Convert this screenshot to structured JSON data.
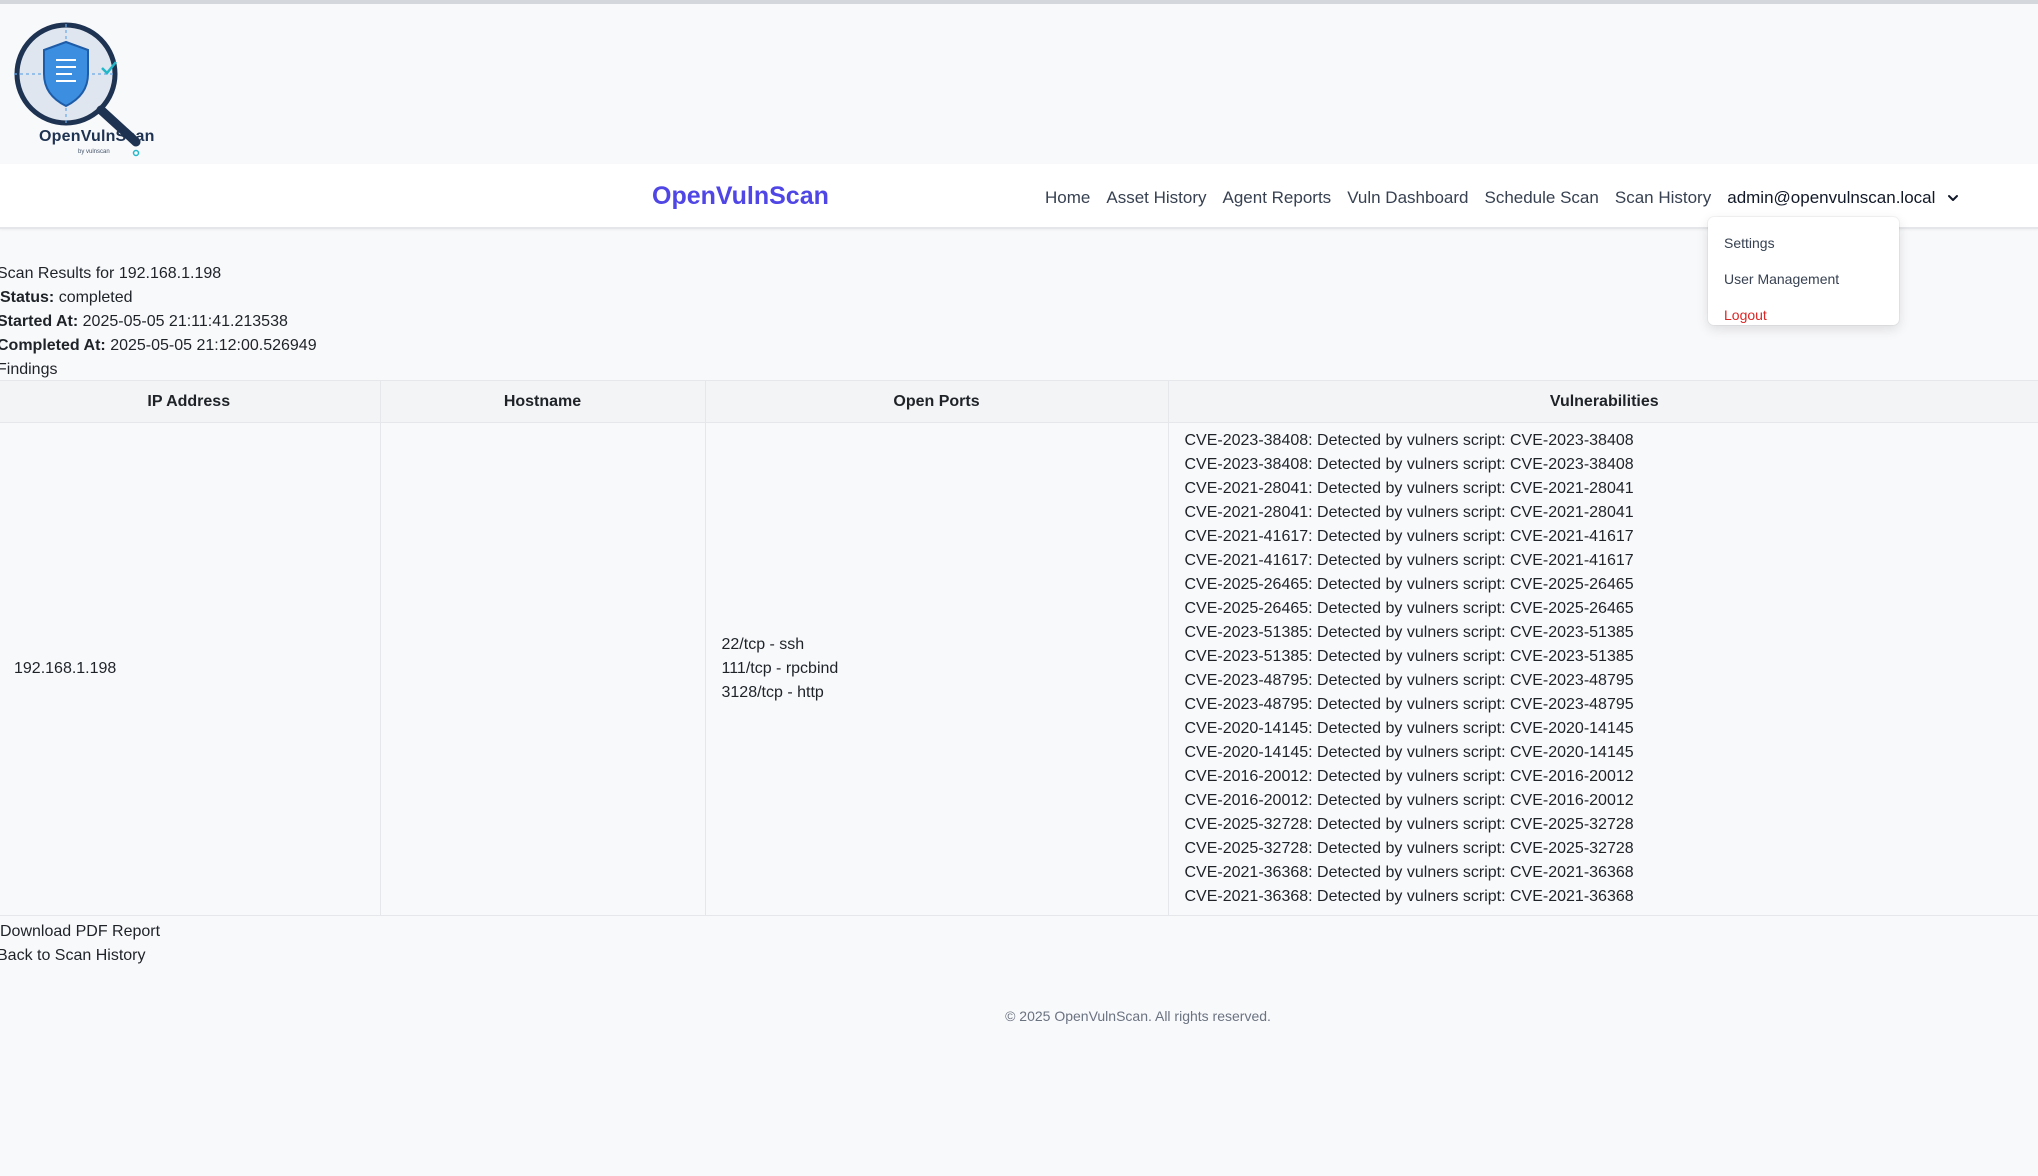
{
  "logo": {
    "name": "OpenVulnScan",
    "subtitle": "by vulnscan"
  },
  "navbar": {
    "brand": "OpenVulnScan",
    "links": [
      "Home",
      "Asset History",
      "Agent Reports",
      "Vuln Dashboard",
      "Schedule Scan",
      "Scan History"
    ],
    "user": "admin@openvulnscan.local",
    "user_icon": "chevron-down-icon"
  },
  "user_dropdown": {
    "items": [
      "Settings",
      "User Management",
      "Logout"
    ]
  },
  "scan": {
    "title_prefix": "Scan Results for",
    "ip": "192.168.1.198",
    "status_label": "Status:",
    "status": "completed",
    "started_label": "Started At:",
    "started": "2025-05-05 21:11:41.213538",
    "completed_label": "Completed At:",
    "completed": "2025-05-05 21:12:00.526949",
    "findings_label": "Findings"
  },
  "table": {
    "headers": [
      "IP Address",
      "Hostname",
      "Open Ports",
      "Vulnerabilities"
    ],
    "row": {
      "ip": "192.168.1.198",
      "hostname": "",
      "ports": [
        "22/tcp - ssh",
        "111/tcp - rpcbind",
        "3128/tcp - http"
      ],
      "vulnerabilities": [
        "CVE-2023-38408: Detected by vulners script: CVE-2023-38408",
        "CVE-2023-38408: Detected by vulners script: CVE-2023-38408",
        "CVE-2021-28041: Detected by vulners script: CVE-2021-28041",
        "CVE-2021-28041: Detected by vulners script: CVE-2021-28041",
        "CVE-2021-41617: Detected by vulners script: CVE-2021-41617",
        "CVE-2021-41617: Detected by vulners script: CVE-2021-41617",
        "CVE-2025-26465: Detected by vulners script: CVE-2025-26465",
        "CVE-2025-26465: Detected by vulners script: CVE-2025-26465",
        "CVE-2023-51385: Detected by vulners script: CVE-2023-51385",
        "CVE-2023-51385: Detected by vulners script: CVE-2023-51385",
        "CVE-2023-48795: Detected by vulners script: CVE-2023-48795",
        "CVE-2023-48795: Detected by vulners script: CVE-2023-48795",
        "CVE-2020-14145: Detected by vulners script: CVE-2020-14145",
        "CVE-2020-14145: Detected by vulners script: CVE-2020-14145",
        "CVE-2016-20012: Detected by vulners script: CVE-2016-20012",
        "CVE-2016-20012: Detected by vulners script: CVE-2016-20012",
        "CVE-2025-32728: Detected by vulners script: CVE-2025-32728",
        "CVE-2025-32728: Detected by vulners script: CVE-2025-32728",
        "CVE-2021-36368: Detected by vulners script: CVE-2021-36368",
        "CVE-2021-36368: Detected by vulners script: CVE-2021-36368"
      ]
    }
  },
  "actions": {
    "download": "Download PDF Report",
    "back": "Back to Scan History"
  },
  "footer": {
    "text": "© 2025 OpenVulnScan. All rights reserved."
  },
  "colors": {
    "brand": "#4f46e5",
    "logout": "#dc2626",
    "logo_shield": "#3b8ee0",
    "logo_ring": "#1e3251"
  }
}
